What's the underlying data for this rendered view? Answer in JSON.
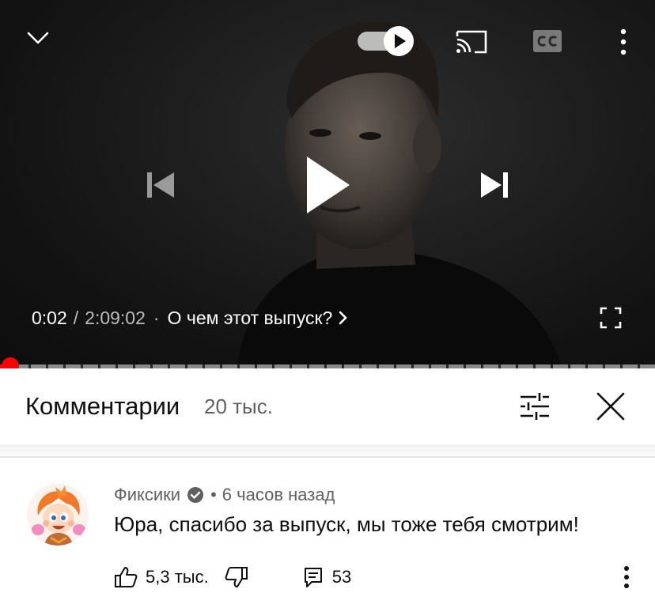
{
  "player": {
    "current_time": "0:02",
    "time_separator": "/",
    "duration": "2:09:02",
    "dot": "·",
    "chapter_title": "О чем этот выпуск?",
    "progress_fraction": 0.003,
    "accent_color": "#ff0000",
    "icons": {
      "collapse": "chevron-down-icon",
      "autoplay": "autoplay-toggle-icon",
      "cast": "cast-icon",
      "captions": "closed-captions-icon",
      "more": "more-vertical-icon",
      "previous": "skip-previous-icon",
      "play": "play-icon",
      "next": "skip-next-icon",
      "chapter_chevron": "chevron-right-icon",
      "fullscreen": "fullscreen-icon"
    }
  },
  "comments": {
    "title": "Комментарии",
    "count": "20 тыс.",
    "icons": {
      "filter": "sliders-icon",
      "close": "close-icon"
    }
  },
  "comment": {
    "author": "Фиксики",
    "meta_dot": "•",
    "time": "6 часов назад",
    "text": "Юра, спасибо за выпуск, мы тоже тебя смотрим!",
    "like_count": "5,3 тыс.",
    "reply_count": "53",
    "icons": {
      "avatar": "avatar-image",
      "verified": "verified-badge-icon",
      "like": "thumb-up-icon",
      "dislike": "thumb-down-icon",
      "reply": "reply-icon",
      "more": "more-vertical-icon"
    }
  }
}
